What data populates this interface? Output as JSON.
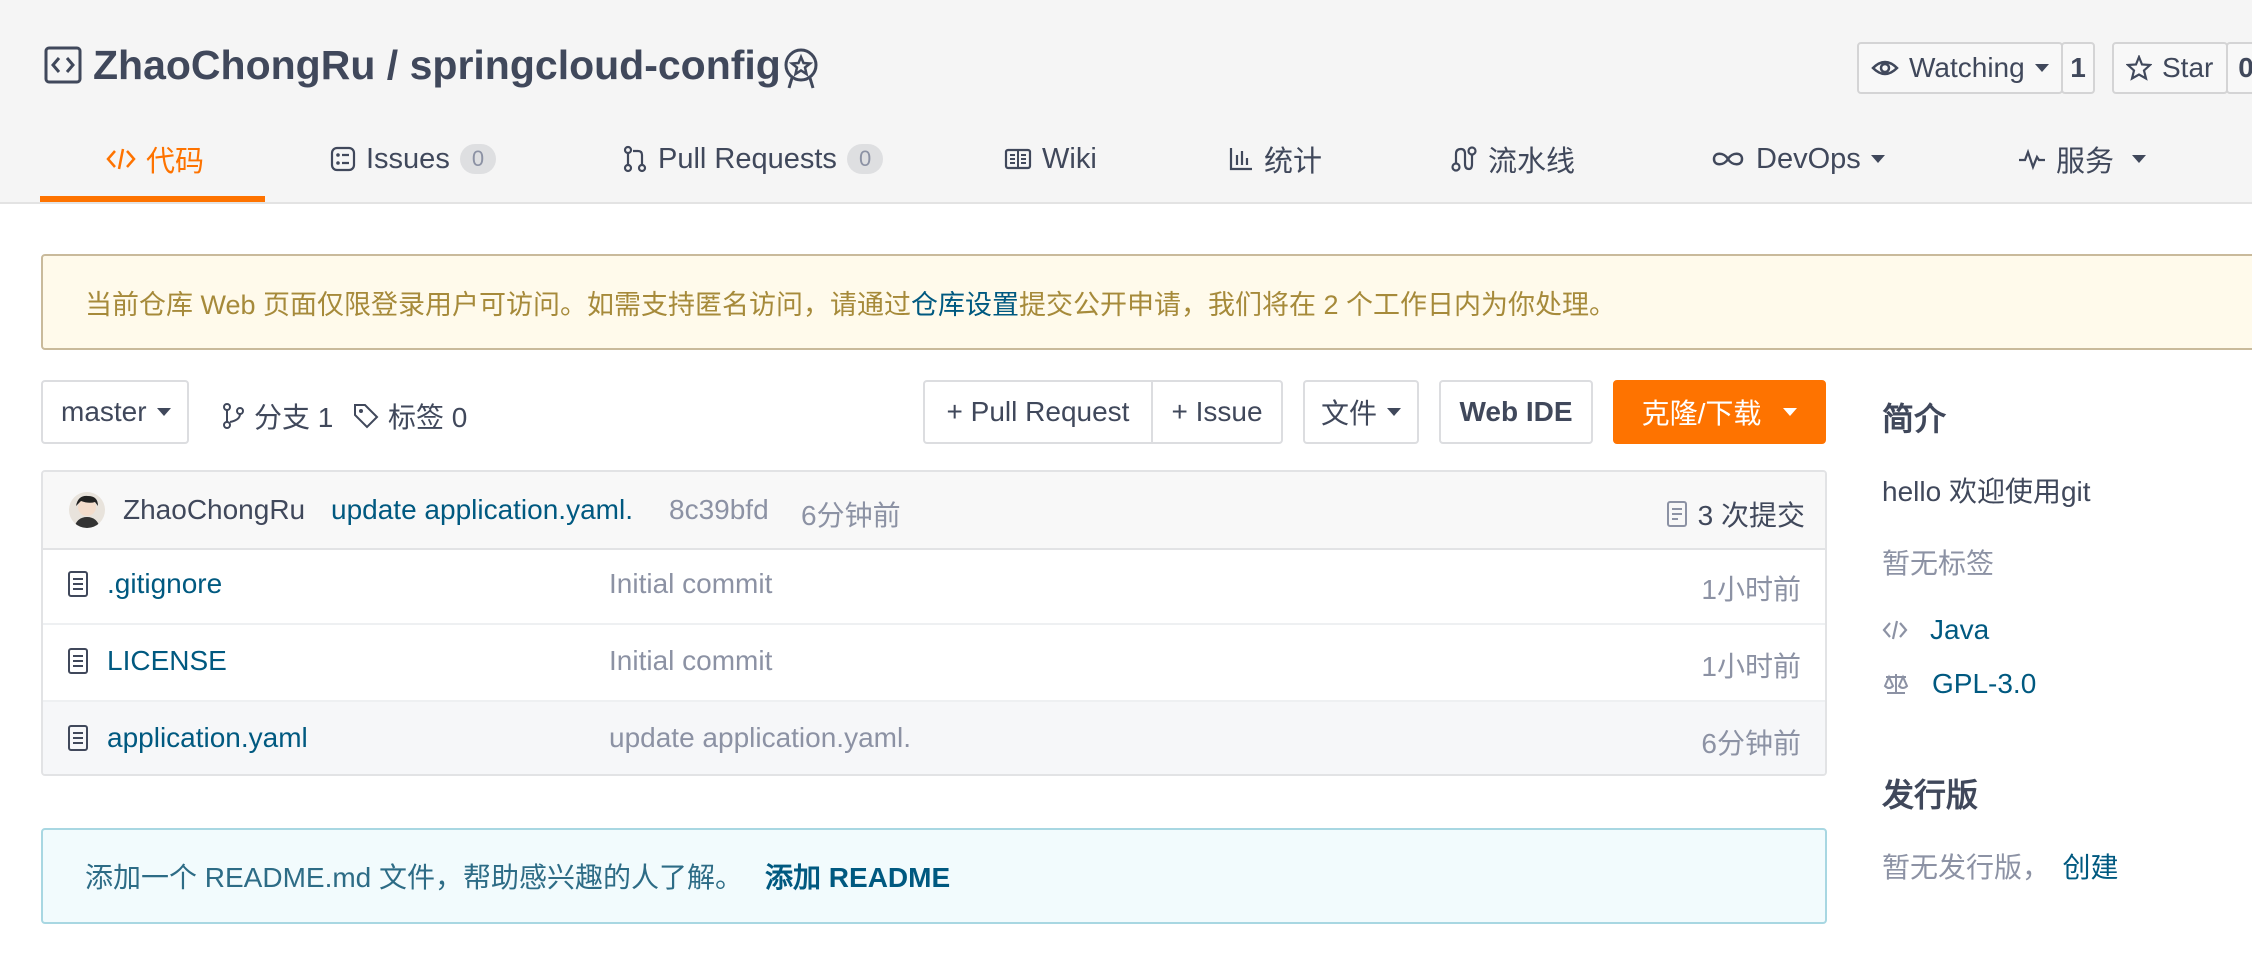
{
  "repo": {
    "owner": "ZhaoChongRu",
    "separator": "/",
    "name": "springcloud-config"
  },
  "watch": {
    "label": "Watching",
    "count": "1"
  },
  "star": {
    "label": "Star",
    "count": "0"
  },
  "tabs": [
    {
      "label": "代码",
      "icon": "code-icon",
      "active": true
    },
    {
      "label": "Issues",
      "count": "0",
      "icon": "issues-icon"
    },
    {
      "label": "Pull Requests",
      "count": "0",
      "icon": "pull-request-icon"
    },
    {
      "label": "Wiki",
      "icon": "wiki-icon"
    },
    {
      "label": "统计",
      "icon": "chart-icon"
    },
    {
      "label": "流水线",
      "icon": "pipeline-icon"
    },
    {
      "label": "DevOps",
      "icon": "devops-icon"
    },
    {
      "label": "服务",
      "icon": "pulse-icon"
    }
  ],
  "notice": {
    "before": "当前仓库 Web 页面仅限登录用户可访问。如需支持匿名访问，请通过 ",
    "link": "仓库设置",
    "after": " 提交公开申请，我们将在 2 个工作日内为你处理。"
  },
  "toolbar": {
    "branch": "master",
    "branches": "分支 1",
    "tags": "标签 0",
    "pull_request": "+ Pull Request",
    "issue": "+ Issue",
    "file": "文件",
    "web_ide": "Web IDE",
    "clone": "克隆/下载"
  },
  "commit": {
    "author": "ZhaoChongRu",
    "message": "update application.yaml.",
    "hash": "8c39bfd",
    "time": "6分钟前",
    "count": "3 次提交"
  },
  "files": [
    {
      "name": ".gitignore",
      "message": "Initial commit",
      "time": "1小时前"
    },
    {
      "name": "LICENSE",
      "message": "Initial commit",
      "time": "1小时前"
    },
    {
      "name": "application.yaml",
      "message": "update application.yaml.",
      "time": "6分钟前"
    }
  ],
  "readme_tip": {
    "text": "添加一个 README.md 文件，帮助感兴趣的人了解。",
    "link": "添加 README"
  },
  "sidebar": {
    "intro_title": "简介",
    "description": "hello 欢迎使用git",
    "no_tags": "暂无标签",
    "language": "Java",
    "license": "GPL-3.0",
    "release_title": "发行版",
    "no_release": "暂无发行版，",
    "create": "创建"
  },
  "colors": {
    "accent": "#fe7300",
    "link": "#005980",
    "notice_bg": "#fffaeb",
    "notice_text": "#a68a3a"
  }
}
